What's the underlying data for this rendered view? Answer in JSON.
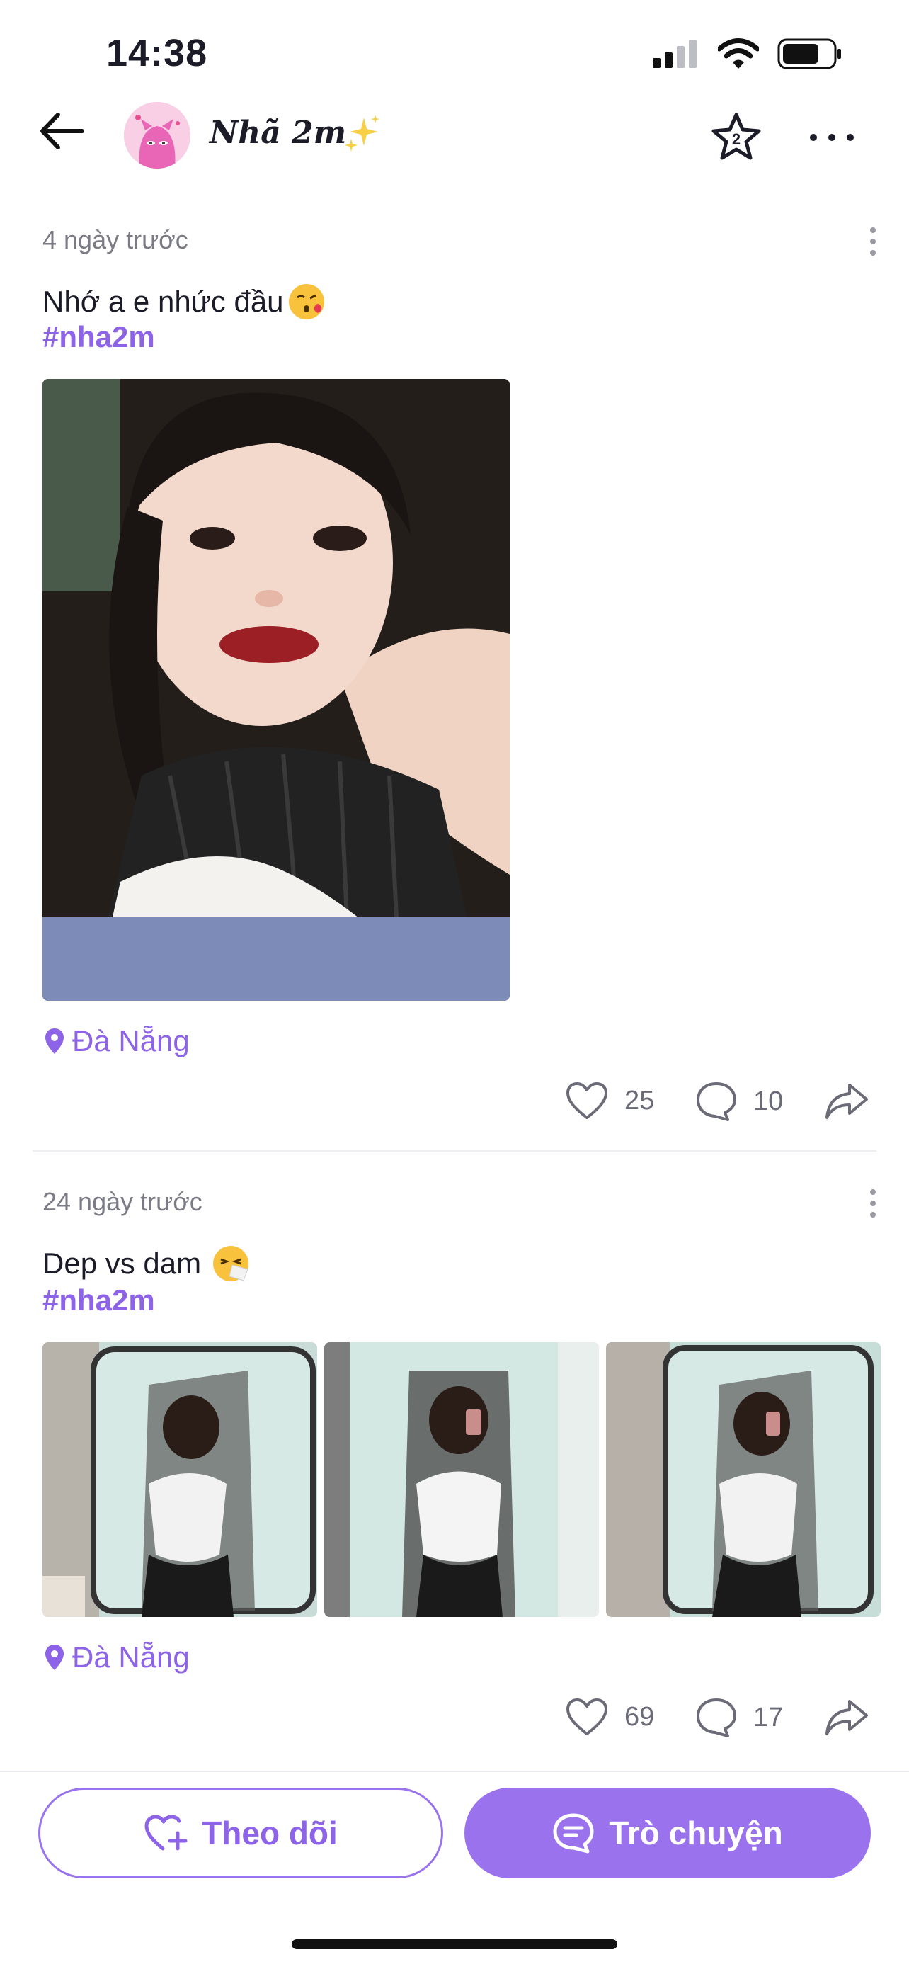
{
  "status_bar": {
    "time": "14:38",
    "signal_icon": "cellular-signal-icon",
    "wifi_icon": "wifi-icon",
    "battery_icon": "battery-icon"
  },
  "header": {
    "name": "Nhã 2m",
    "back_icon": "arrow-left-icon",
    "avatar": "cartoon-avatar",
    "sparkle_icon": "sparkles-emoji",
    "star_icon": "star-badge-icon",
    "more_icon": "more-horizontal-icon"
  },
  "posts": [
    {
      "time": "4 ngày trước",
      "text": "Nhớ a e nhức đầu",
      "emoji": "kissing-face-emoji",
      "hashtag": "#nha2m",
      "images": 1,
      "location": "Đà Nẵng",
      "likes": "25",
      "comments": "10"
    },
    {
      "time": "24 ngày trước",
      "text": "Dep vs dam",
      "emoji": "sneezing-face-emoji",
      "hashtag": "#nha2m",
      "images": 3,
      "location": "Đà Nẵng",
      "likes": "69",
      "comments": "17"
    }
  ],
  "bottom_bar": {
    "follow_label": "Theo dõi",
    "chat_label": "Trò chuyện",
    "follow_icon": "heart-plus-icon",
    "chat_icon": "chat-bubble-icon"
  },
  "colors": {
    "accent": "#8d63e8",
    "accent_fill": "#9b72ee",
    "muted_text": "#7b7b86",
    "text": "#1c1c28"
  }
}
